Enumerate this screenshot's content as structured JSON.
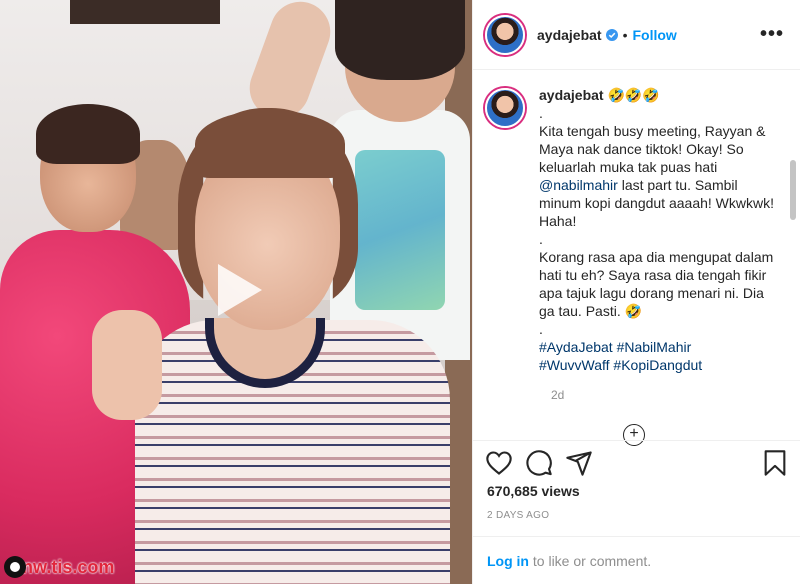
{
  "post": {
    "username": "aydajebat",
    "follow_label": "Follow",
    "separator": "•",
    "more_label": "•••"
  },
  "caption": {
    "username": "aydajebat",
    "emoji_suffix": " 🤣🤣🤣",
    "lines": [
      ".",
      "Kita tengah busy meeting, Rayyan & Maya nak dance tiktok! Okay! So keluarlah muka tak puas hati",
      "@nabilmahir last part tu. Sambil minum kopi dangdut aaaah! Wkwkwk! Haha!",
      ".",
      "Korang rasa apa dia mengupat dalam hati tu eh? Saya rasa dia tengah fikir apa tajuk lagu dorang menari ni. Dia ga tau. Pasti. 🤣",
      ".",
      "#AydaJebat #NabilMahir",
      "#WuvvWaff #KopiDangdut"
    ],
    "age": "2d"
  },
  "stats": {
    "views": "670,685 views",
    "posted": "2 DAYS AGO"
  },
  "login": {
    "link": "Log in",
    "rest": " to like or comment."
  },
  "watermark": {
    "text": "nw.tis.com"
  },
  "colors": {
    "accent_blue": "#0095f6",
    "verified_blue": "#3897f0",
    "watermark_red": "#e1253b"
  },
  "icons": [
    "play-icon",
    "verified-badge-icon",
    "heart-icon",
    "comment-icon",
    "share-icon",
    "bookmark-icon",
    "more-options-icon",
    "load-more-icon"
  ]
}
